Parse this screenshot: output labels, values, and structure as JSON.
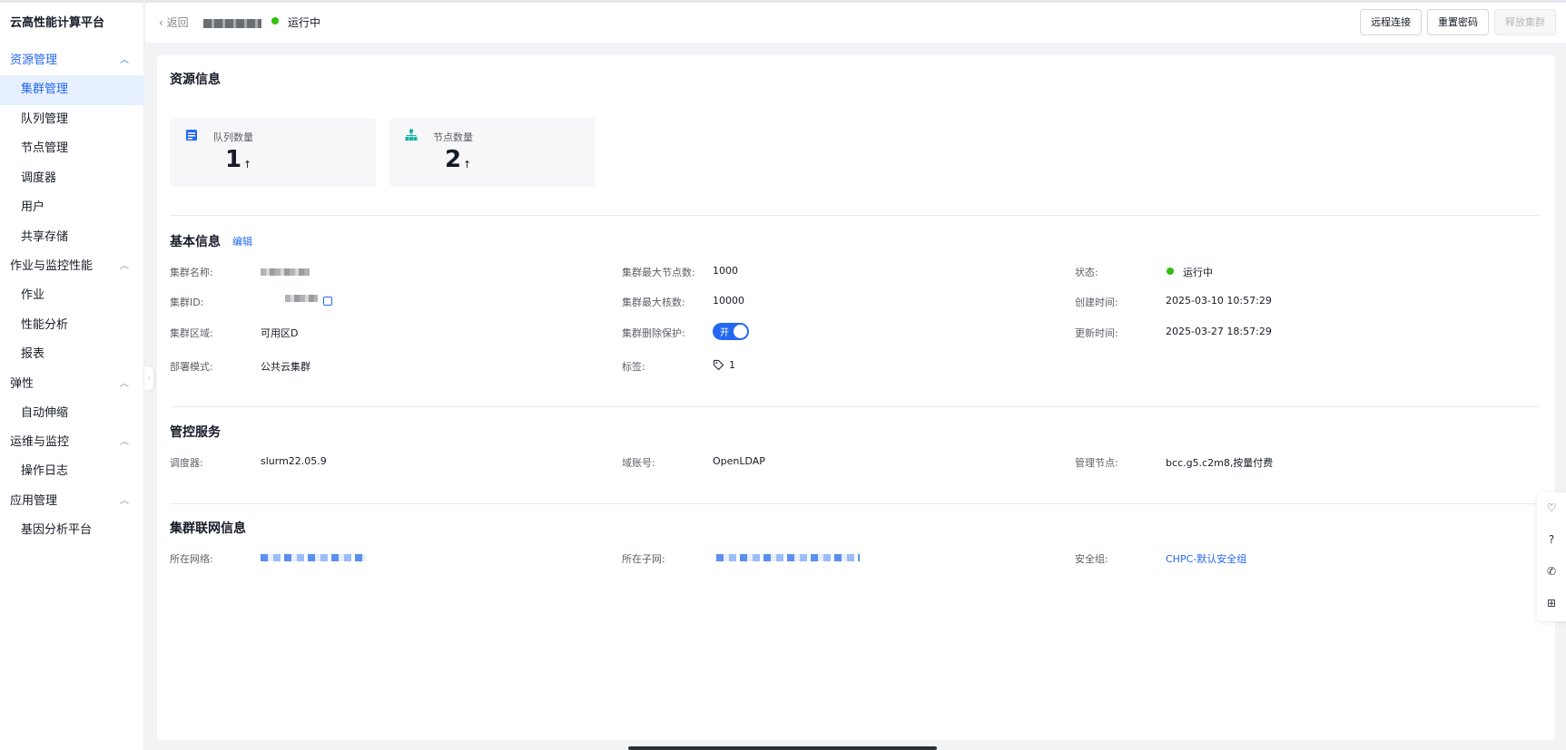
{
  "sidebar": {
    "brand": "云高性能计算平台",
    "groups": [
      {
        "label": "资源管理",
        "items": [
          "集群管理",
          "队列管理",
          "节点管理",
          "调度器",
          "用户",
          "共享存储"
        ]
      },
      {
        "label": "作业与监控性能",
        "items": [
          "作业",
          "性能分析",
          "报表"
        ]
      },
      {
        "label": "弹性",
        "items": [
          "自动伸缩"
        ]
      },
      {
        "label": "运维与监控",
        "items": [
          "操作日志"
        ]
      },
      {
        "label": "应用管理",
        "items": [
          "基因分析平台"
        ]
      }
    ]
  },
  "topbar": {
    "back_label": "返回",
    "status": "运行中",
    "buttons": {
      "remote": "远程连接",
      "reset": "重置密码",
      "release": "释放集群"
    }
  },
  "resource": {
    "title": "资源信息",
    "queue_label": "队列数量",
    "queue_value": "1",
    "node_label": "节点数量",
    "node_value": "2",
    "arrow": "↑"
  },
  "basic": {
    "title": "基本信息",
    "edit": "编辑",
    "name_label": "集群名称:",
    "id_label": "集群ID:",
    "zone_label": "集群区域:",
    "zone_value": "可用区D",
    "deploy_label": "部署模式:",
    "deploy_value": "公共云集群",
    "max_nodes_label": "集群最大节点数:",
    "max_nodes_value": "1000",
    "max_cores_label": "集群最大核数:",
    "max_cores_value": "10000",
    "protect_label": "集群删除保护:",
    "protect_value": "开",
    "tags_label": "标签:",
    "tags_value": "1",
    "state_label": "状态:",
    "state_value": "运行中",
    "created_label": "创建时间:",
    "created_value": "2025-03-10 10:57:29",
    "updated_label": "更新时间:",
    "updated_value": "2025-03-27 18:57:29"
  },
  "control": {
    "title": "管控服务",
    "scheduler_label": "调度器:",
    "scheduler_value": "slurm22.05.9",
    "domain_label": "域账号:",
    "domain_value": "OpenLDAP",
    "mgmt_label": "管理节点:",
    "mgmt_value": "bcc.g5.c2m8,按量付费"
  },
  "network": {
    "title": "集群联网信息",
    "vpc_label": "所在网络:",
    "subnet_label": "所在子网:",
    "sg_label": "安全组:",
    "sg_value": "CHPC-默认安全组"
  },
  "colors": {
    "accent": "#2468f2",
    "running": "#30bf13"
  }
}
